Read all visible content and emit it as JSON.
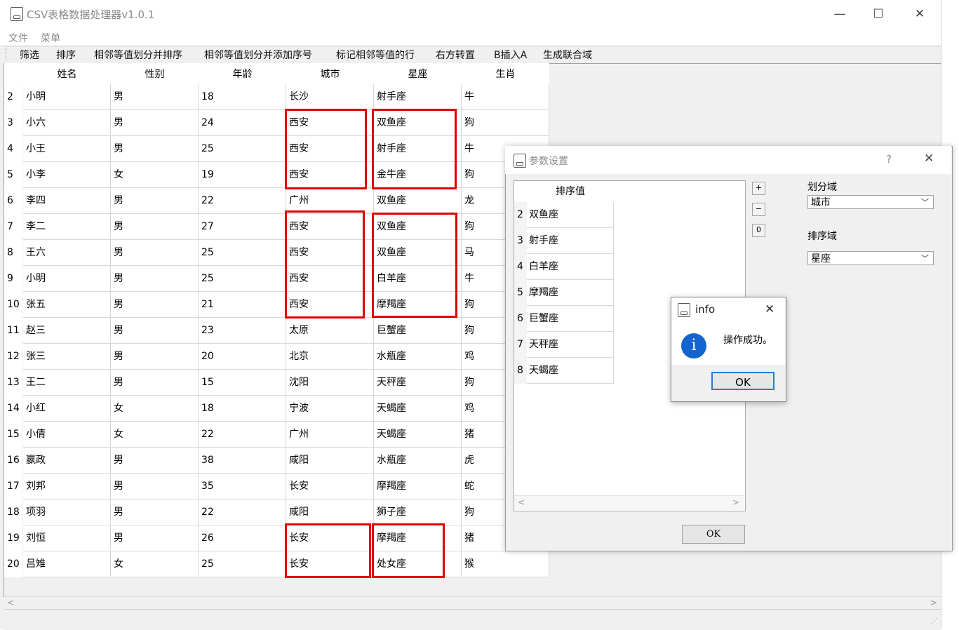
{
  "window": {
    "title": "CSV表格数据处理器v1.0.1",
    "controls": [
      "—",
      "☐",
      "✕"
    ]
  },
  "menu": [
    "文件",
    "菜单"
  ],
  "toolbar": [
    "筛选",
    "排序",
    "相邻等值划分并排序",
    "相邻等值划分并添加序号",
    "标记相邻等值的行",
    "右方转置",
    "B插入A",
    "生成联合域"
  ],
  "table": {
    "headers": [
      "姓名",
      "性别",
      "年龄",
      "城市",
      "星座",
      "生肖"
    ],
    "rows": [
      {
        "n": "2",
        "c": [
          "小明",
          "男",
          "18",
          "长沙",
          "射手座",
          "牛"
        ]
      },
      {
        "n": "3",
        "c": [
          "小六",
          "男",
          "24",
          "西安",
          "双鱼座",
          "狗"
        ]
      },
      {
        "n": "4",
        "c": [
          "小王",
          "男",
          "25",
          "西安",
          "射手座",
          "牛"
        ]
      },
      {
        "n": "5",
        "c": [
          "小李",
          "女",
          "19",
          "西安",
          "金牛座",
          "狗"
        ]
      },
      {
        "n": "6",
        "c": [
          "李四",
          "男",
          "22",
          "广州",
          "双鱼座",
          "龙"
        ]
      },
      {
        "n": "7",
        "c": [
          "李二",
          "男",
          "27",
          "西安",
          "双鱼座",
          "狗"
        ]
      },
      {
        "n": "8",
        "c": [
          "王六",
          "男",
          "25",
          "西安",
          "双鱼座",
          "马"
        ]
      },
      {
        "n": "9",
        "c": [
          "小明",
          "男",
          "25",
          "西安",
          "白羊座",
          "牛"
        ]
      },
      {
        "n": "10",
        "c": [
          "张五",
          "男",
          "21",
          "西安",
          "摩羯座",
          "狗"
        ]
      },
      {
        "n": "11",
        "c": [
          "赵三",
          "男",
          "23",
          "太原",
          "巨蟹座",
          "狗"
        ]
      },
      {
        "n": "12",
        "c": [
          "张三",
          "男",
          "20",
          "北京",
          "水瓶座",
          "鸡"
        ]
      },
      {
        "n": "13",
        "c": [
          "王二",
          "男",
          "15",
          "沈阳",
          "天秤座",
          "狗"
        ]
      },
      {
        "n": "14",
        "c": [
          "小红",
          "女",
          "18",
          "宁波",
          "天蝎座",
          "鸡"
        ]
      },
      {
        "n": "15",
        "c": [
          "小倩",
          "女",
          "22",
          "广州",
          "天蝎座",
          "猪"
        ]
      },
      {
        "n": "16",
        "c": [
          "嬴政",
          "男",
          "38",
          "咸阳",
          "水瓶座",
          "虎"
        ]
      },
      {
        "n": "17",
        "c": [
          "刘邦",
          "男",
          "35",
          "长安",
          "摩羯座",
          "蛇"
        ]
      },
      {
        "n": "18",
        "c": [
          "项羽",
          "男",
          "22",
          "咸阳",
          "狮子座",
          "狗"
        ]
      },
      {
        "n": "19",
        "c": [
          "刘恒",
          "男",
          "26",
          "长安",
          "摩羯座",
          "猪"
        ]
      },
      {
        "n": "20",
        "c": [
          "吕雉",
          "女",
          "25",
          "长安",
          "处女座",
          "猴"
        ]
      }
    ]
  },
  "param_dialog": {
    "title": "参数设置",
    "help": "?",
    "close": "✕",
    "list_header": "排序值",
    "list": [
      {
        "n": "2",
        "v": "双鱼座"
      },
      {
        "n": "3",
        "v": "射手座"
      },
      {
        "n": "4",
        "v": "白羊座"
      },
      {
        "n": "5",
        "v": "摩羯座"
      },
      {
        "n": "6",
        "v": "巨蟹座"
      },
      {
        "n": "7",
        "v": "天秤座"
      },
      {
        "n": "8",
        "v": "天蝎座"
      }
    ],
    "buttons": [
      "+",
      "−",
      "0"
    ],
    "partition_label": "划分域",
    "partition_value": "城市",
    "sort_label": "排序域",
    "sort_value": "星座",
    "ok": "OK"
  },
  "info_dialog": {
    "title": "info",
    "close": "✕",
    "icon": "i",
    "message": "操作成功。",
    "ok": "OK"
  },
  "colors": {
    "highlight": "#e00000",
    "info_icon": "#1463cf",
    "focus_border": "#2f76d8"
  }
}
